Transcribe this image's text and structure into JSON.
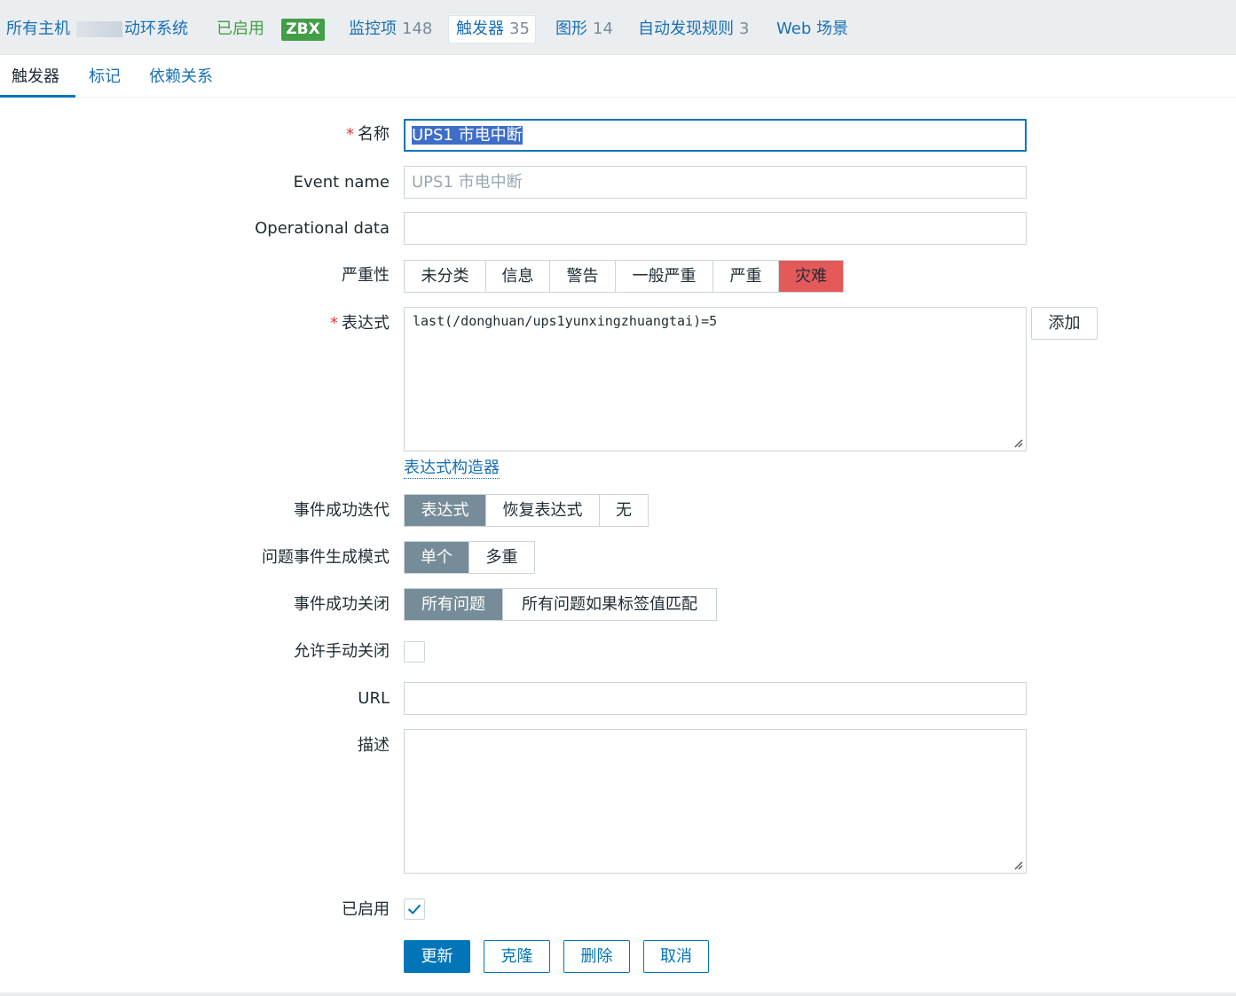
{
  "host_nav": {
    "all_hosts": "所有主机",
    "host_name": "动环系统",
    "status": "已启用",
    "zbx_badge": "ZBX",
    "items": {
      "label": "监控项",
      "count": "148"
    },
    "triggers": {
      "label": "触发器",
      "count": "35"
    },
    "graphs": {
      "label": "图形",
      "count": "14"
    },
    "discovery": {
      "label": "自动发现规则",
      "count": "3"
    },
    "web": {
      "label": "Web 场景"
    }
  },
  "tabs": [
    {
      "label": "触发器",
      "selected": true
    },
    {
      "label": "标记",
      "selected": false
    },
    {
      "label": "依赖关系",
      "selected": false
    }
  ],
  "form": {
    "name": {
      "label": "名称",
      "required": "*",
      "value": "UPS1 市电中断"
    },
    "event_name": {
      "label": "Event name",
      "placeholder": "UPS1 市电中断"
    },
    "operational_data": {
      "label": "Operational data",
      "value": ""
    },
    "severity": {
      "label": "严重性",
      "options": [
        "未分类",
        "信息",
        "警告",
        "一般严重",
        "严重",
        "灾难"
      ],
      "selected": "灾难",
      "selected_color": "#e45959"
    },
    "expression": {
      "label": "表达式",
      "required": "*",
      "value": "last(/donghuan/ups1yunxingzhuangtai)=5",
      "add_button": "添加",
      "builder_link": "表达式构造器"
    },
    "ok_event_generation": {
      "label": "事件成功迭代",
      "options": [
        "表达式",
        "恢复表达式",
        "无"
      ],
      "selected": "表达式"
    },
    "problem_event_mode": {
      "label": "问题事件生成模式",
      "options": [
        "单个",
        "多重"
      ],
      "selected": "单个"
    },
    "ok_event_closes": {
      "label": "事件成功关闭",
      "options": [
        "所有问题",
        "所有问题如果标签值匹配"
      ],
      "selected": "所有问题"
    },
    "allow_manual_close": {
      "label": "允许手动关闭",
      "checked": false
    },
    "url": {
      "label": "URL",
      "value": ""
    },
    "description": {
      "label": "描述",
      "value": ""
    },
    "enabled": {
      "label": "已启用",
      "checked": true
    }
  },
  "buttons": {
    "update": "更新",
    "clone": "克隆",
    "delete": "删除",
    "cancel": "取消"
  }
}
